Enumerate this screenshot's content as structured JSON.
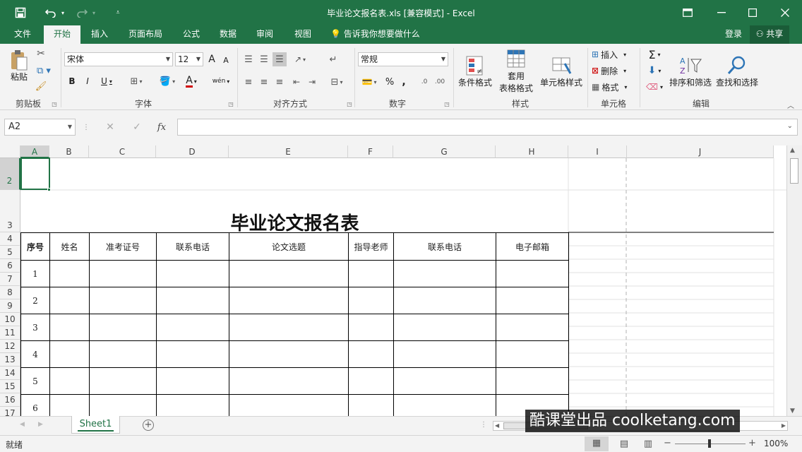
{
  "window": {
    "title": "毕业论文报名表.xls  [兼容模式] - Excel",
    "accent": "#217346"
  },
  "tabs": [
    {
      "label": "文件"
    },
    {
      "label": "开始",
      "active": true
    },
    {
      "label": "插入"
    },
    {
      "label": "页面布局"
    },
    {
      "label": "公式"
    },
    {
      "label": "数据"
    },
    {
      "label": "审阅"
    },
    {
      "label": "视图"
    }
  ],
  "tell_me": "告诉我你想要做什么",
  "account": {
    "login": "登录",
    "share": "共享"
  },
  "ribbon": {
    "clipboard": {
      "paste": "粘贴",
      "label": "剪贴板"
    },
    "font": {
      "name": "宋体",
      "size": "12",
      "label": "字体",
      "bold": "B",
      "italic": "I",
      "underline": "U",
      "grow": "A",
      "shrink": "A",
      "color_a": "A",
      "wen": "wén",
      "font_color": "#d00000"
    },
    "alignment": {
      "label": "对齐方式"
    },
    "number": {
      "format": "常规",
      "label": "数字",
      "percent": "%",
      "comma": ","
    },
    "styles": {
      "cond": "条件格式",
      "table1": "套用",
      "table2": "表格格式",
      "cell": "单元格样式",
      "label": "样式"
    },
    "cells": {
      "insert": "插入",
      "delete": "删除",
      "format": "格式",
      "label": "单元格"
    },
    "editing": {
      "sort": "排序和筛选",
      "find": "查找和选择",
      "label": "编辑"
    }
  },
  "formula_bar": {
    "name_box": "A2",
    "fx": "fx",
    "value": ""
  },
  "columns": [
    "A",
    "B",
    "C",
    "D",
    "E",
    "F",
    "G",
    "H",
    "I",
    "J"
  ],
  "rows": [
    "2",
    "3",
    "4",
    "5",
    "6",
    "7",
    "8",
    "9",
    "10",
    "11",
    "12",
    "13",
    "14",
    "15",
    "16",
    "17"
  ],
  "sheet": {
    "title": "毕业论文报名表",
    "headers": [
      "序号",
      "姓名",
      "准考证号",
      "联系电话",
      "论文选题",
      "指导老师",
      "联系电话",
      "电子邮箱"
    ],
    "serials": [
      "1",
      "2",
      "3",
      "4",
      "5",
      "6"
    ]
  },
  "sheet_tabs": [
    {
      "label": "Sheet1"
    }
  ],
  "status": {
    "ready": "就绪",
    "zoom": "100%",
    "minus": "−",
    "plus": "+"
  },
  "watermark": "酷课堂出品 coolketang.com"
}
